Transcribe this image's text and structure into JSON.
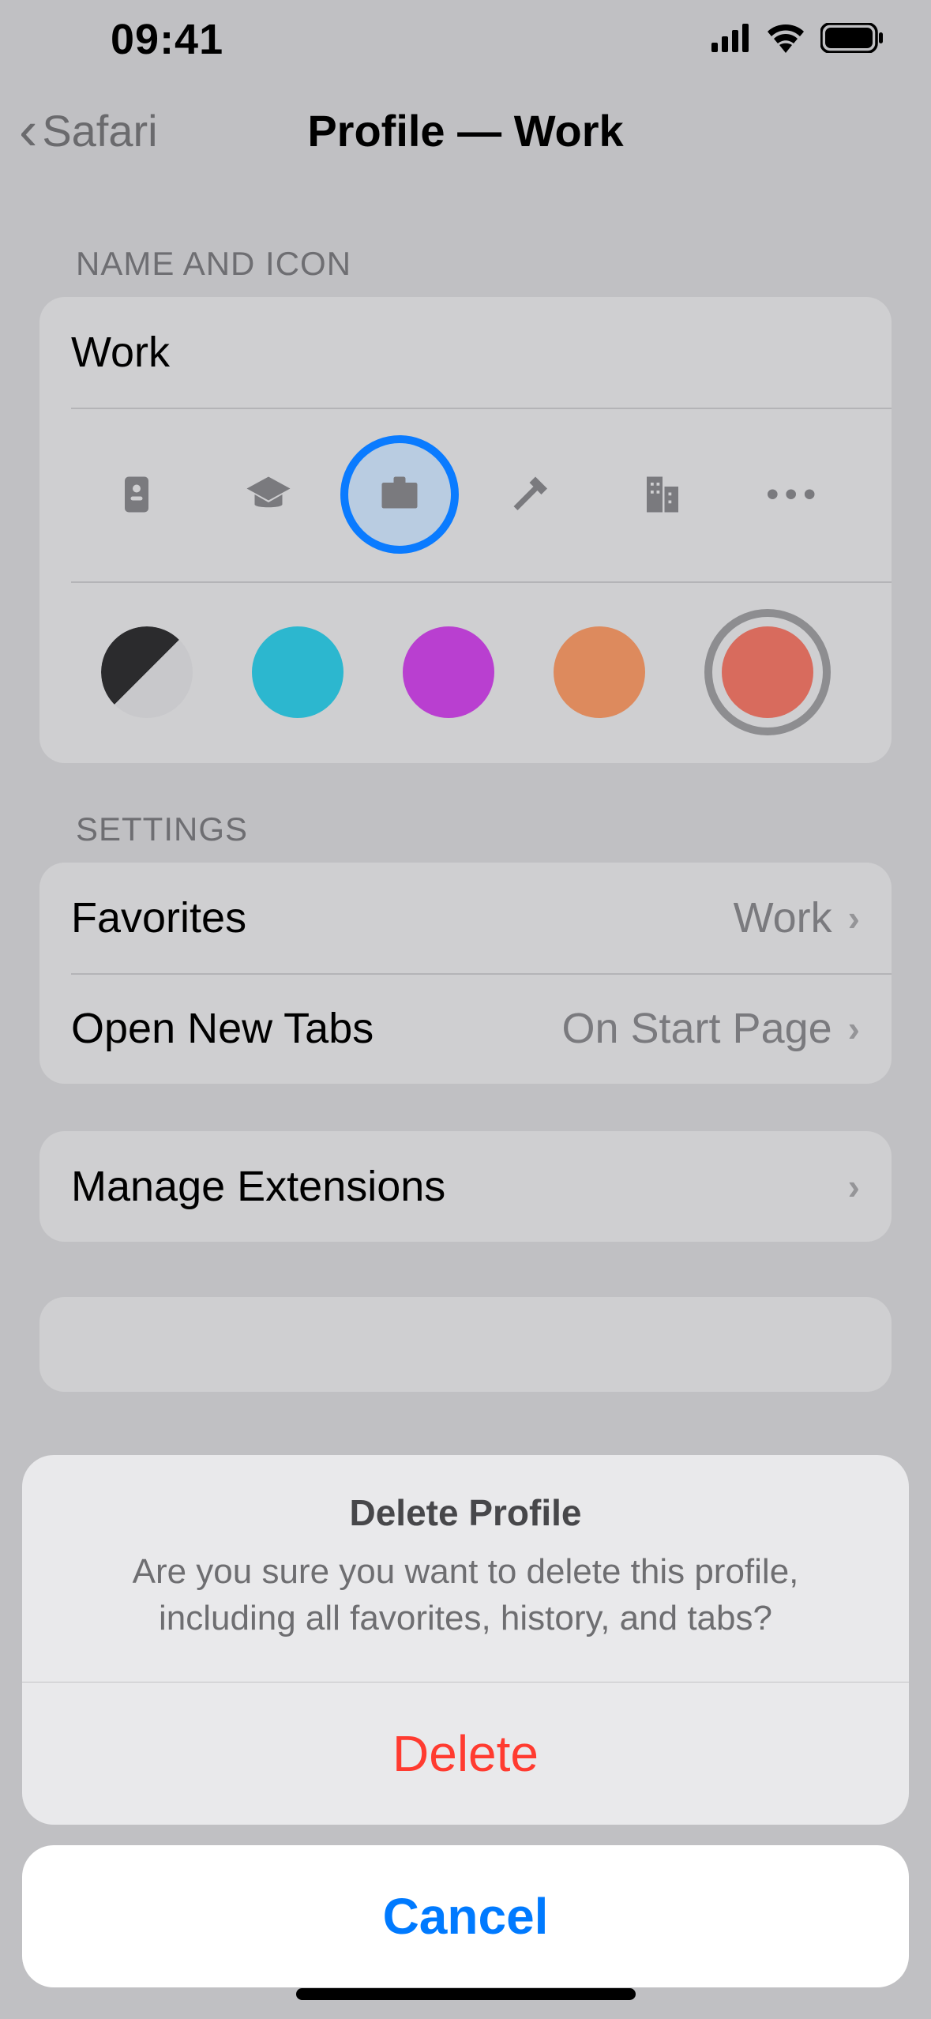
{
  "status": {
    "time": "09:41"
  },
  "nav": {
    "back_label": "Safari",
    "title": "Profile — Work"
  },
  "sections": {
    "name_icon_header": "NAME AND ICON",
    "settings_header": "SETTINGS"
  },
  "profile": {
    "name": "Work",
    "icons": [
      "badge",
      "graduation",
      "briefcase",
      "hammer",
      "building",
      "more"
    ],
    "selected_icon": "briefcase",
    "colors": [
      "black-white",
      "teal",
      "purple",
      "orange",
      "coral"
    ],
    "selected_color": "coral",
    "color_hex": {
      "teal": "#2cb7cf",
      "purple": "#b93fd0",
      "orange": "#dd8a5d",
      "coral": "#d86b5d"
    }
  },
  "settings": {
    "favorites": {
      "label": "Favorites",
      "value": "Work"
    },
    "new_tabs": {
      "label": "Open New Tabs",
      "value": "On Start Page"
    },
    "extensions": {
      "label": "Manage Extensions"
    }
  },
  "sheet": {
    "title": "Delete Profile",
    "message": "Are you sure you want to delete this profile, including all favorites, history, and tabs?",
    "delete_label": "Delete",
    "cancel_label": "Cancel"
  }
}
